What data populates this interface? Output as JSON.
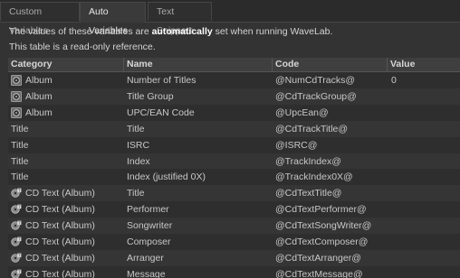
{
  "tabs": [
    {
      "label": "Custom Variables"
    },
    {
      "label": "Auto Variables"
    },
    {
      "label": "Text Snippets"
    }
  ],
  "info": {
    "line1_pre": "The values of these variables are ",
    "line1_bold": "automatically",
    "line1_post": " set when running WaveLab.",
    "line2": "This table is a read-only reference."
  },
  "table": {
    "headers": {
      "category": "Category",
      "name": "Name",
      "code": "Code",
      "value": "Value"
    },
    "rows": [
      {
        "icon": "album-icon",
        "category": "Album",
        "name": "Number of Titles",
        "code": "@NumCdTracks@",
        "value": "0"
      },
      {
        "icon": "album-icon",
        "category": "Album",
        "name": "Title Group",
        "code": "@CdTrackGroup@",
        "value": ""
      },
      {
        "icon": "album-icon",
        "category": "Album",
        "name": "UPC/EAN Code",
        "code": "@UpcEan@",
        "value": ""
      },
      {
        "icon": "",
        "category": "Title",
        "name": "Title",
        "code": "@CdTrackTitle@",
        "value": ""
      },
      {
        "icon": "",
        "category": "Title",
        "name": "ISRC",
        "code": "@ISRC@",
        "value": ""
      },
      {
        "icon": "",
        "category": "Title",
        "name": "Index",
        "code": "@TrackIndex@",
        "value": ""
      },
      {
        "icon": "",
        "category": "Title",
        "name": "Index (justified 0X)",
        "code": "@TrackIndex0X@",
        "value": ""
      },
      {
        "icon": "cd-text-icon",
        "category": "CD Text (Album)",
        "name": "Title",
        "code": "@CdTextTitle@",
        "value": ""
      },
      {
        "icon": "cd-text-icon",
        "category": "CD Text (Album)",
        "name": "Performer",
        "code": "@CdTextPerformer@",
        "value": ""
      },
      {
        "icon": "cd-text-icon",
        "category": "CD Text (Album)",
        "name": "Songwriter",
        "code": "@CdTextSongWriter@",
        "value": ""
      },
      {
        "icon": "cd-text-icon",
        "category": "CD Text (Album)",
        "name": "Composer",
        "code": "@CdTextComposer@",
        "value": ""
      },
      {
        "icon": "cd-text-icon",
        "category": "CD Text (Album)",
        "name": "Arranger",
        "code": "@CdTextArranger@",
        "value": ""
      },
      {
        "icon": "cd-text-icon",
        "category": "CD Text (Album)",
        "name": "Message",
        "code": "@CdTextMessage@",
        "value": ""
      }
    ]
  }
}
